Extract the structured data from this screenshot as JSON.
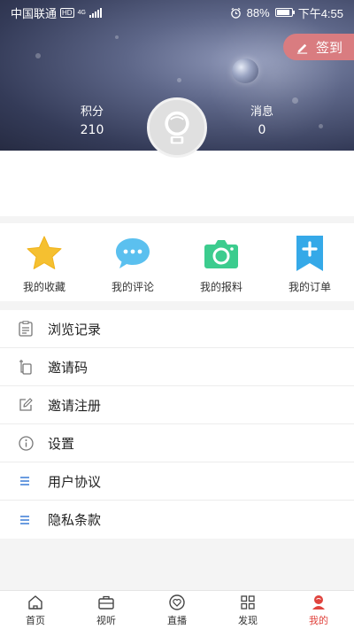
{
  "status_bar": {
    "carrier": "中国联通",
    "network_hd": "HD",
    "network_type": "4G",
    "battery": "88%",
    "time": "下午4:55",
    "icons": [
      "alarm-icon",
      "battery-icon",
      "signal-icon"
    ]
  },
  "header": {
    "signin_label": "签到",
    "points_label": "积分",
    "points_value": "210",
    "messages_label": "消息",
    "messages_value": "0"
  },
  "quick_actions": [
    {
      "label": "我的收藏",
      "icon": "star-icon",
      "color": "#f5c030"
    },
    {
      "label": "我的评论",
      "icon": "chat-bubble-icon",
      "color": "#5bc0ef"
    },
    {
      "label": "我的报料",
      "icon": "camera-icon",
      "color": "#3ccc8e"
    },
    {
      "label": "我的订单",
      "icon": "bookmark-plus-icon",
      "color": "#35a9e8"
    }
  ],
  "menu": [
    {
      "label": "浏览记录",
      "icon": "history-list-icon"
    },
    {
      "label": "邀请码",
      "icon": "invite-code-icon"
    },
    {
      "label": "邀请注册",
      "icon": "edit-icon"
    },
    {
      "label": "设置",
      "icon": "info-circle-icon"
    },
    {
      "label": "用户协议",
      "icon": "lines-icon"
    },
    {
      "label": "隐私条款",
      "icon": "lines-icon"
    }
  ],
  "tabs": [
    {
      "label": "首页",
      "icon": "home-icon"
    },
    {
      "label": "视听",
      "icon": "briefcase-icon"
    },
    {
      "label": "直播",
      "icon": "live-heart-icon"
    },
    {
      "label": "发现",
      "icon": "grid-icon"
    },
    {
      "label": "我的",
      "icon": "profile-icon",
      "active": true
    }
  ],
  "colors": {
    "accent_red": "#e0443e",
    "signin_bg": "#d97c80"
  }
}
